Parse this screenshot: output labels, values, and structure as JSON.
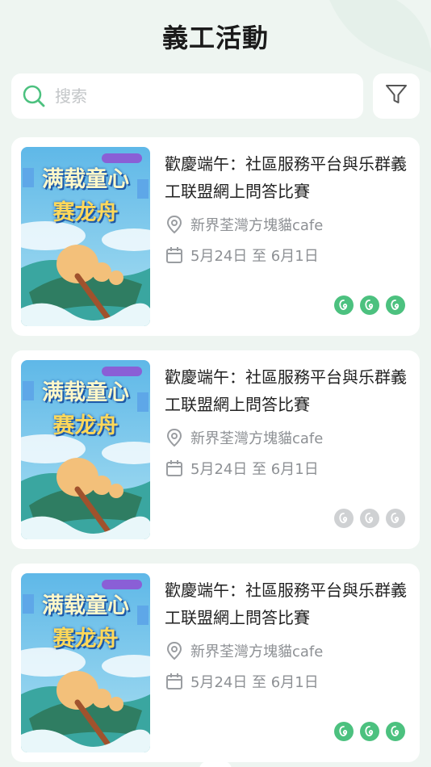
{
  "header": {
    "title": "義工活動"
  },
  "search": {
    "placeholder": "搜索",
    "value": ""
  },
  "colors": {
    "accent": "#4cc17f",
    "inactive": "#cfd1d3",
    "background": "#eef5f1"
  },
  "cards": [
    {
      "title": "歡慶端午：社區服務平台與乐群義工联盟網上問答比賽",
      "location": "新界荃灣方塊貓cafe",
      "date": "5月24日 至 6月1日",
      "badge_state": "active",
      "poster_text": {
        "line1": "满载童心",
        "line2": "赛龙舟"
      }
    },
    {
      "title": "歡慶端午：社區服務平台與乐群義工联盟網上問答比賽",
      "location": "新界荃灣方塊貓cafe",
      "date": "5月24日 至 6月1日",
      "badge_state": "inactive",
      "poster_text": {
        "line1": "满载童心",
        "line2": "赛龙舟"
      }
    },
    {
      "title": "歡慶端午：社區服務平台與乐群義工联盟網上問答比賽",
      "location": "新界荃灣方塊貓cafe",
      "date": "5月24日 至 6月1日",
      "badge_state": "active",
      "poster_text": {
        "line1": "满载童心",
        "line2": "赛龙舟"
      }
    }
  ]
}
